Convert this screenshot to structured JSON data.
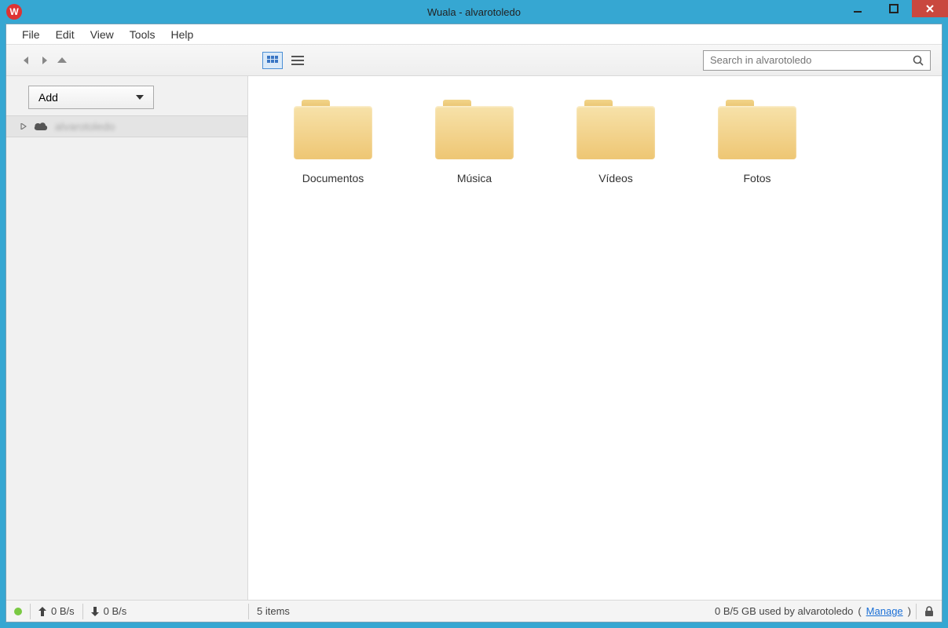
{
  "titlebar": {
    "title": "Wuala - alvarotoledo",
    "app_letter": "W"
  },
  "menubar": {
    "items": [
      "File",
      "Edit",
      "View",
      "Tools",
      "Help"
    ]
  },
  "toolbar": {
    "search_placeholder": "Search in alvarotoledo"
  },
  "sidebar": {
    "add_label": "Add",
    "tree": {
      "root_label": "alvarotoledo"
    }
  },
  "main": {
    "folders": [
      {
        "name": "Documentos"
      },
      {
        "name": "Música"
      },
      {
        "name": "Vídeos"
      },
      {
        "name": "Fotos"
      }
    ]
  },
  "statusbar": {
    "upload_rate": "0 B/s",
    "download_rate": "0 B/s",
    "item_count": "5 items",
    "storage_text": "0 B/5 GB used by alvarotoledo",
    "manage_label": "Manage"
  }
}
